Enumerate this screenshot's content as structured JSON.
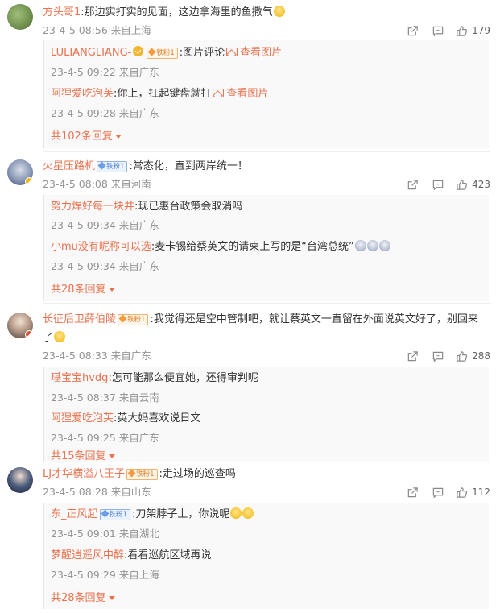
{
  "comments": [
    {
      "user": "方头哥1",
      "text": ":那边实打实的见面，这边拿海里的鱼撒气",
      "time": "23-4-5 08:56 来自上海",
      "likes": "179",
      "avatar_badge": "none",
      "replies": [
        {
          "user": "LULIANGLIANG-",
          "badges": [
            "vip-icon",
            "铁粉1"
          ],
          "text": ":图片评论",
          "link": "查看图片",
          "time": "23-4-5 09:22 来自广东"
        },
        {
          "user": "阿狸爱吃泡芙",
          "text": ":你上，扛起键盘就打",
          "link": "查看图片",
          "time": "23-4-5 09:28 来自广东"
        }
      ],
      "more": "共102条回复"
    },
    {
      "user": "火星压路机",
      "badge": "铁粉1",
      "text": ":常态化，直到两岸统一！",
      "time": "23-4-5 08:08 来自河南",
      "likes": "423",
      "avatar_badge": "yellow",
      "replies": [
        {
          "user": "努力焊好每一块井",
          "text": ":现已惠台政策会取消吗",
          "time": "23-4-5 09:34 来自广东"
        },
        {
          "user": "小mu没有昵称可以选",
          "text": ":麦卡锡给蔡英文的请柬上写的是“台湾总统”",
          "time": "23-4-5 09:34 来自广东"
        }
      ],
      "more": "共28条回复"
    },
    {
      "user": "长征后卫薛伯陵",
      "badge": "铁粉1",
      "text_line1": ":我觉得还是空中管制吧，就让蔡英文一直留在外面说英文好了，别回来",
      "text_line2": "了",
      "time": "23-4-5 08:33 来自广东",
      "likes": "288",
      "avatar_badge": "red",
      "replies": [
        {
          "user": "璂宝宝hvdg",
          "text": ":怎可能那么便宜她，还得审判呢",
          "time": "23-4-5 08:37 来自云南"
        },
        {
          "user": "阿狸爱吃泡芙",
          "text": ":英大妈喜欢说日文",
          "time": "23-4-5 09:25 来自广东"
        }
      ],
      "more": "共15条回复"
    },
    {
      "user": "LJ才华横溢八王子",
      "badge": "铁粉1",
      "text": ":走过场的巡查吗",
      "time": "23-4-5 08:28 来自山东",
      "likes": "112",
      "avatar_badge": "none",
      "replies": [
        {
          "user": "东_正风起",
          "badge": "铁粉1",
          "text": ":刀架脖子上，你说呢",
          "time": "23-4-5 09:01 来自湖北"
        },
        {
          "user": "梦醒逍遥风中醉",
          "text": ":看看巡航区域再说",
          "time": "23-4-5 09:29 来自上海"
        }
      ],
      "more": "共28条回复"
    }
  ],
  "icons": {
    "share": "share-icon",
    "comment": "comment-icon",
    "like": "like-icon"
  },
  "colors": {
    "username": "#eb7350",
    "meta": "#939393",
    "text": "#333333"
  }
}
